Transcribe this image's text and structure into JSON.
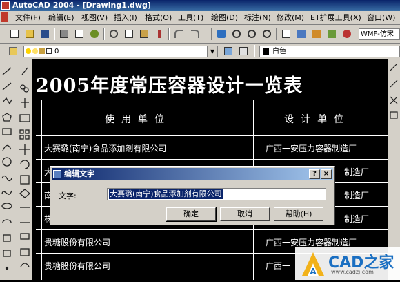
{
  "window": {
    "title": "AutoCAD 2004 - [Drawing1.dwg]"
  },
  "menu": [
    "文件(F)",
    "编辑(E)",
    "视图(V)",
    "插入(I)",
    "格式(O)",
    "工具(T)",
    "绘图(D)",
    "标注(N)",
    "修改(M)",
    "ET扩展工具(X)",
    "窗口(W)"
  ],
  "toolbar": {
    "textstyle_combo": "WMF-仿宋"
  },
  "properties": {
    "layer_value": "0",
    "color_value": "白色"
  },
  "drawing": {
    "title": "2005年度常压容器设计一览表",
    "headers": [
      "使用单位",
      "设计单位"
    ],
    "rows": [
      {
        "user": "大赛璐(南宁)食品添加剂有限公司",
        "designer": "广西一安压力容器制造厂"
      },
      {
        "user": "大",
        "designer": "制造厂"
      },
      {
        "user": "南",
        "designer": "制造厂"
      },
      {
        "user": "株",
        "designer": "制造厂"
      },
      {
        "user": "贵糖股份有限公司",
        "designer": "广西一安压力容器制造厂"
      },
      {
        "user": "贵糖股份有限公司",
        "designer": "广西一"
      }
    ]
  },
  "dialog": {
    "title": "编辑文字",
    "label": "文字:",
    "value": "大赛璐(南宁)食品添加剂有限公司",
    "ok": "确定",
    "cancel": "取消",
    "help": "帮助(H)",
    "help_caption": "?",
    "close_caption": "×"
  },
  "watermark": {
    "name": "CAD之家",
    "url": "www.cadzj.com"
  }
}
